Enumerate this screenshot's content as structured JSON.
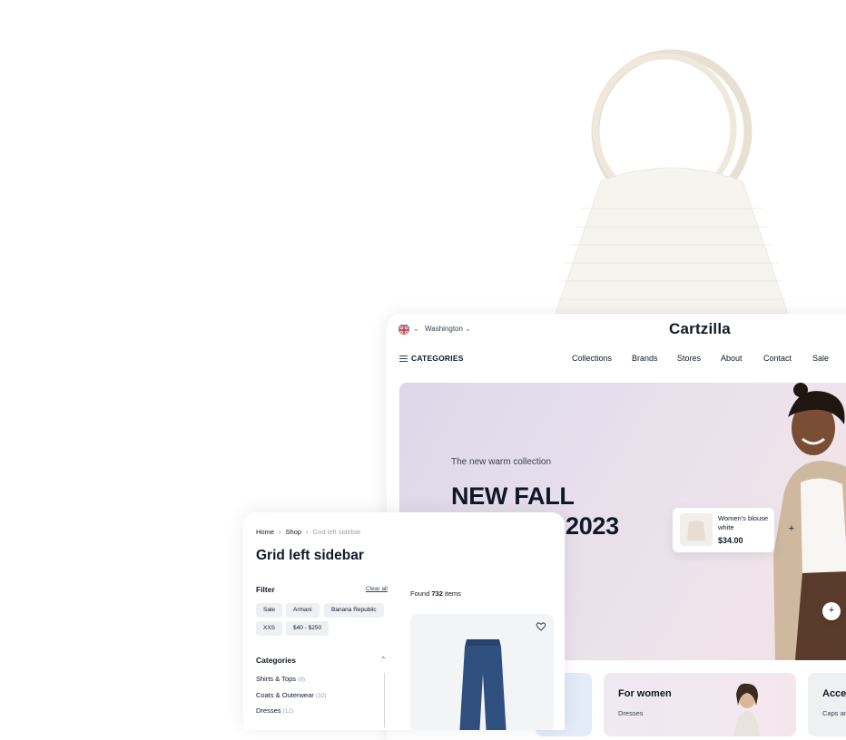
{
  "store": {
    "city": "Washington",
    "brand": "Cartzilla",
    "categories_label": "CATEGORIES",
    "nav": [
      "Collections",
      "Brands",
      "Stores",
      "About",
      "Contact",
      "Sale"
    ],
    "hero": {
      "subtitle": "The new warm collection",
      "title_line1": "NEW FALL",
      "title_year": "2023"
    },
    "product_card": {
      "name": "Women's blouse white",
      "price": "$34.00"
    },
    "hotspot_label": "+",
    "tiles": [
      {
        "title": "For women",
        "sub": "Dresses"
      },
      {
        "title": "Acce",
        "sub": "Caps an"
      }
    ]
  },
  "shop": {
    "breadcrumb": [
      "Home",
      "Shop",
      "Grid left sidebar"
    ],
    "breadcrumb_sep": "›",
    "title": "Grid left sidebar",
    "filter_label": "Filter",
    "clear_all": "Clear all",
    "chips": [
      "Sale",
      "Armani",
      "Banana Republic",
      "XXS",
      "$40 - $250"
    ],
    "categories_label": "Categories",
    "categories": [
      {
        "name": "Shirts & Tops",
        "count": "(8)"
      },
      {
        "name": "Coats & Outerwear",
        "count": "(32)"
      },
      {
        "name": "Dresses",
        "count": "(12)"
      }
    ],
    "found_prefix": "Found",
    "found_count": "732",
    "found_suffix": "items"
  },
  "icons": {
    "flag": "uk-flag-icon",
    "menu": "hamburger-menu-icon",
    "caret_up": "chevron-up-icon",
    "wishlist": "heart-icon"
  }
}
